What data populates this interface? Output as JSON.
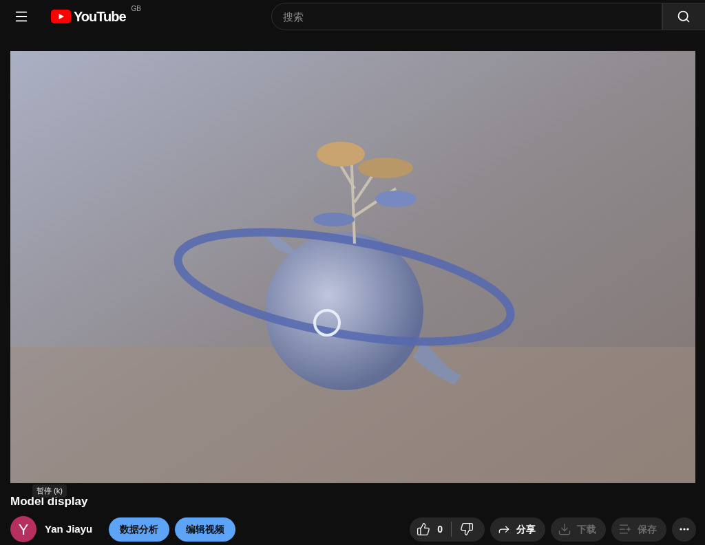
{
  "header": {
    "logo": "YouTube",
    "region": "GB",
    "search": {
      "placeholder": "搜索"
    }
  },
  "video": {
    "kind": "picture",
    "tooltip": "暂停 (k)"
  },
  "title": "Model display",
  "channel": {
    "avatar_letter": "Y",
    "name": "Yan Jiayu",
    "color": "#b5305e"
  },
  "owner_buttons": [
    "数据分析",
    "编辑视频"
  ],
  "like": {
    "count": "0"
  },
  "actions": [
    {
      "kind": "share",
      "label": "分享",
      "disabled": false
    },
    {
      "kind": "download",
      "label": "下载",
      "disabled": true
    },
    {
      "kind": "save",
      "label": "保存",
      "disabled": true
    }
  ]
}
